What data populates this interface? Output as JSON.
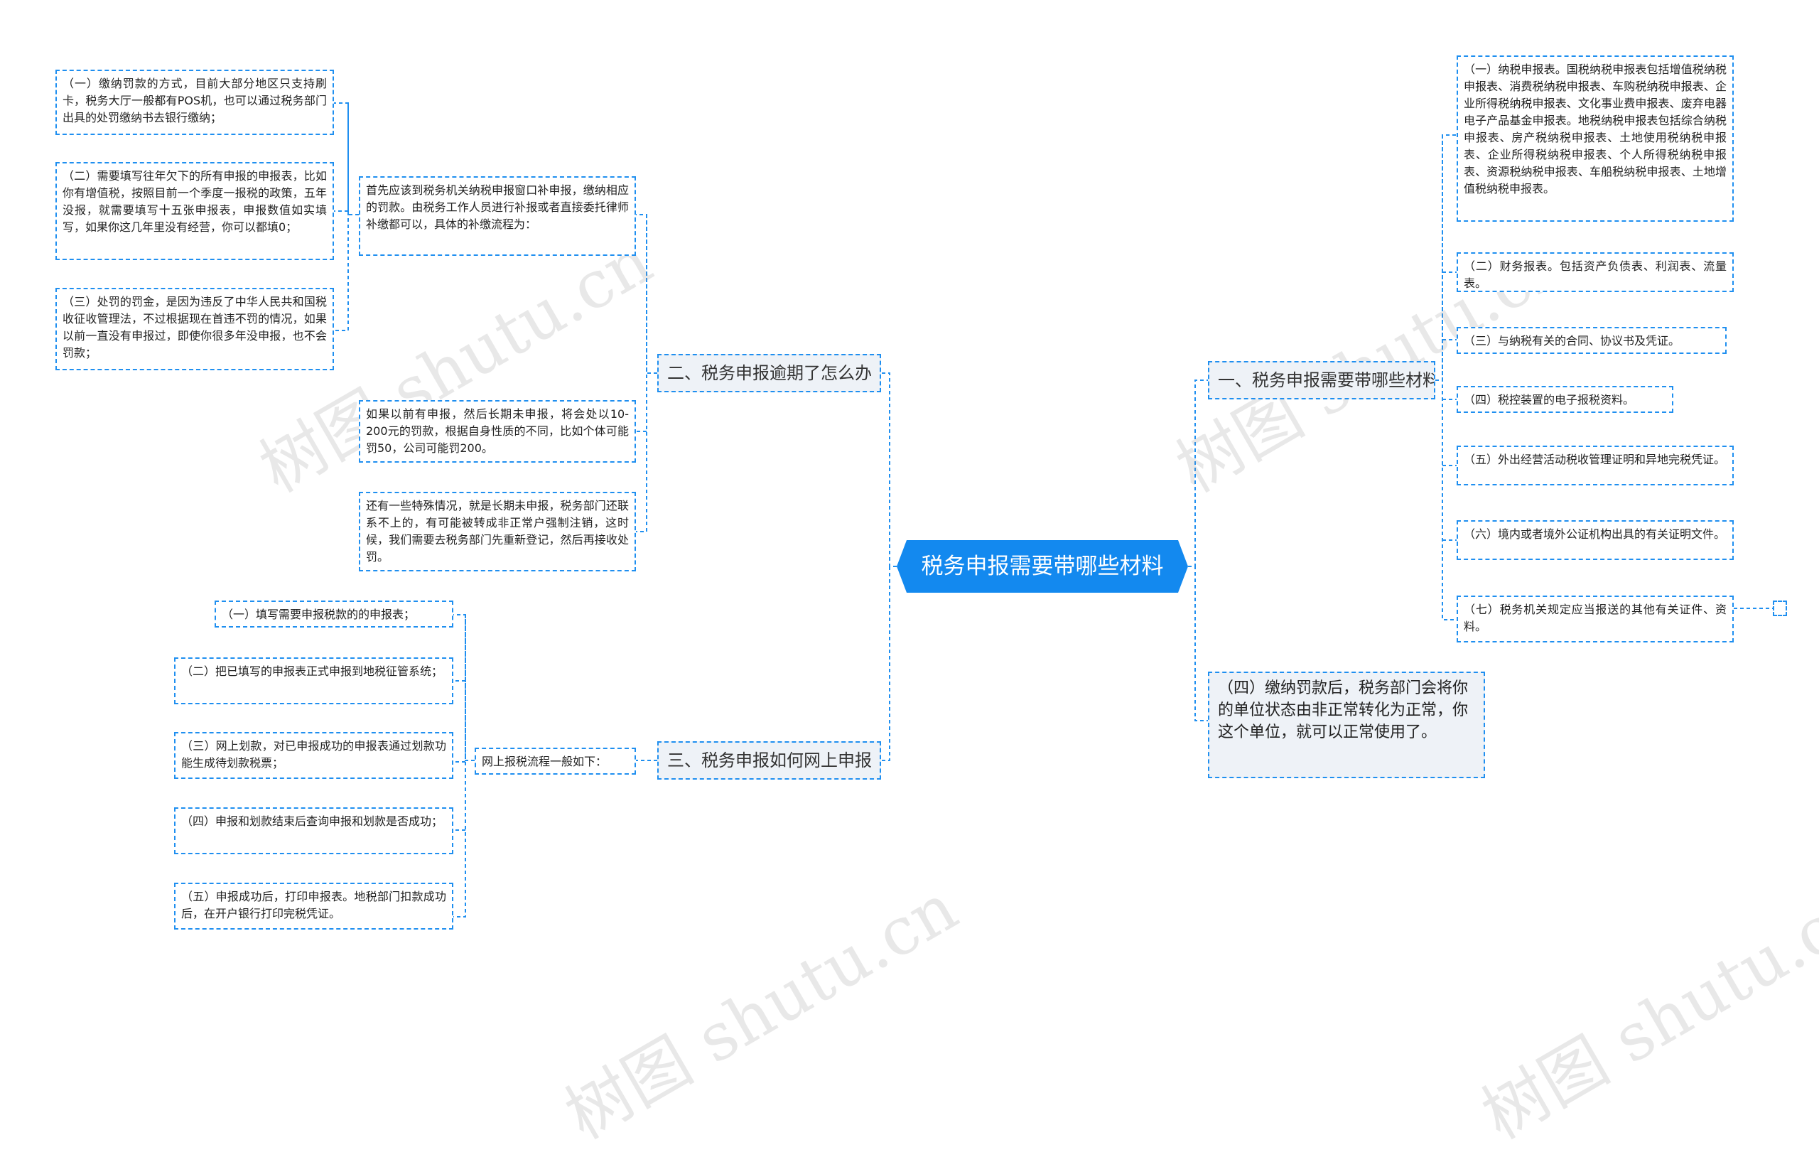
{
  "root": {
    "label": "税务申报需要带哪些材料"
  },
  "branches": {
    "b1": {
      "label": "一、税务申报需要带哪些材料",
      "items": [
        "（一）纳税申报表。国税纳税申报表包括增值税纳税申报表、消费税纳税申报表、车购税纳税申报表、企业所得税纳税申报表、文化事业费申报表、废弃电器电子产品基金申报表。地税纳税申报表包括综合纳税申报表、房产税纳税申报表、土地使用税纳税申报表、企业所得税纳税申报表、个人所得税纳税申报表、资源税纳税申报表、车船税纳税申报表、土地增值税纳税申报表。",
        "（二）财务报表。包括资产负债表、利润表、流量表。",
        "（三）与纳税有关的合同、协议书及凭证。",
        "（四）税控装置的电子报税资料。",
        "（五）外出经营活动税收管理证明和异地完税凭证。",
        "（六）境内或者境外公证机构出具的有关证明文件。",
        "（七）税务机关规定应当报送的其他有关证件、资料。"
      ]
    },
    "b2": {
      "label": "二、税务申报逾期了怎么办",
      "intro": "首先应该到税务机关纳税申报窗口补申报，缴纳相应的罚款。由税务工作人员进行补报或者直接委托律师补缴都可以，具体的补缴流程为：",
      "sub": [
        "（一）缴纳罚款的方式，目前大部分地区只支持刷卡，税务大厅一般都有POS机，也可以通过税务部门出具的处罚缴纳书去银行缴纳；",
        "（二）需要填写往年欠下的所有申报的申报表，比如你有增值税，按照目前一个季度一报税的政策，五年没报，就需要填写十五张申报表，申报数值如实填写，如果你这几年里没有经营，你可以都填0；",
        "（三）处罚的罚金，是因为违反了中华人民共和国税收征收管理法，不过根据现在首违不罚的情况，如果以前一直没有申报过，即使你很多年没申报，也不会罚款；"
      ],
      "note1": "如果以前有申报，然后长期未申报，将会处以10-200元的罚款，根据自身性质的不同，比如个体可能罚50，公司可能罚200。",
      "note2": "还有一些特殊情况，就是长期未申报，税务部门还联系不上的，有可能被转成非正常户强制注销，这时候，我们需要去税务部门先重新登记，然后再接收处罚。"
    },
    "b3": {
      "label": "三、税务申报如何网上申报",
      "intro": "网上报税流程一般如下：",
      "steps": [
        "（一）填写需要申报税款的的申报表；",
        "（二）把已填写的申报表正式申报到地税征管系统；",
        "（三）网上划款，对已申报成功的申报表通过划款功能生成待划款税票；",
        "（四）申报和划款结束后查询申报和划款是否成功；",
        "（五）申报成功后，打印申报表。地税部门扣款成功后，在开户银行打印完税凭证。"
      ]
    },
    "b4": {
      "label": "（四）缴纳罚款后，税务部门会将你的单位状态由非正常转化为正常，你这个单位，就可以正常使用了。"
    }
  },
  "watermark": "树图 shutu.cn",
  "colors": {
    "line": "#1f8ff0",
    "root_bg": "#1389ef",
    "branch_bg": "#eef2f7"
  }
}
